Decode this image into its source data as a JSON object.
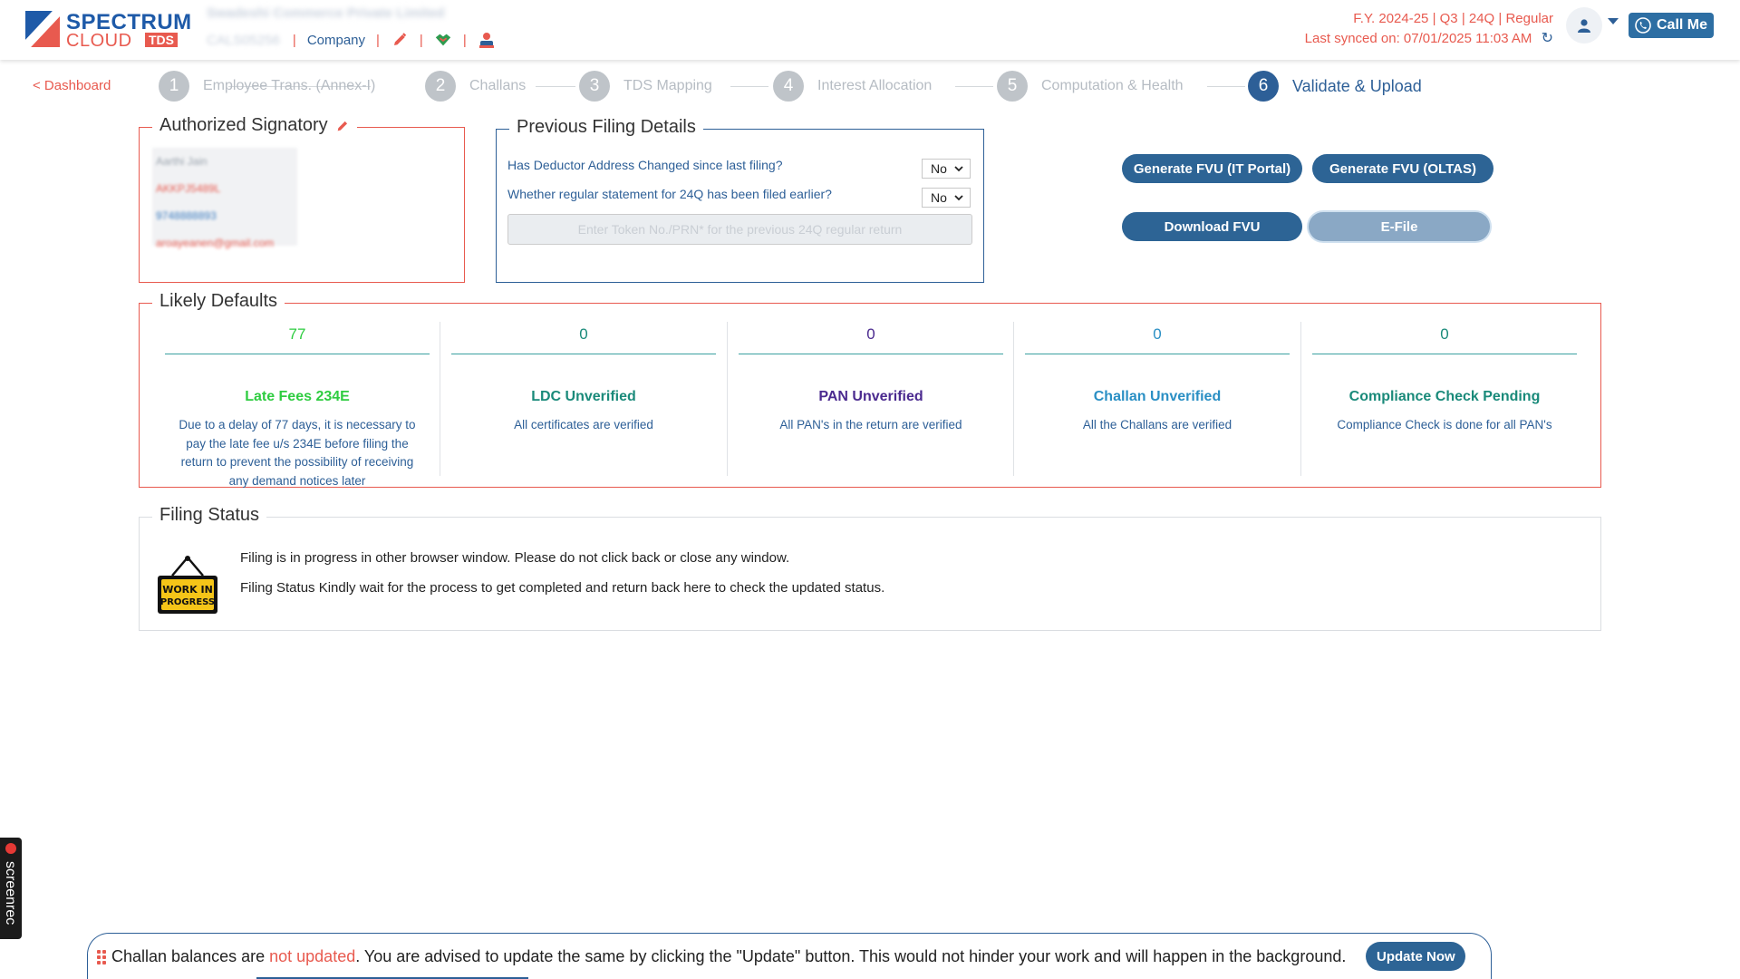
{
  "header": {
    "logo": {
      "line1": "SPECTRUM",
      "line2": "CLOUD",
      "badge": "TDS"
    },
    "company_name": "Swadeshi Commerce Private Limited",
    "tan": "CALS05256",
    "company_link": "Company",
    "separator": "|",
    "fy_line": "F.Y. 2024-25  | Q3  | 24Q | Regular",
    "sync_line": "Last synced on: 07/01/2025 11:03 AM",
    "call_me": "Call Me"
  },
  "nav": {
    "back": "< Dashboard",
    "steps": [
      {
        "num": "1",
        "label": "Employee Trans. (Annex-I)"
      },
      {
        "num": "2",
        "label": "Challans"
      },
      {
        "num": "3",
        "label": "TDS Mapping"
      },
      {
        "num": "4",
        "label": "Interest Allocation"
      },
      {
        "num": "5",
        "label": "Computation & Health"
      },
      {
        "num": "6",
        "label": "Validate & Upload"
      }
    ],
    "active_step": 6
  },
  "signatory": {
    "title": "Authorized Signatory",
    "name": "Aarthi Jain",
    "pan": "AKKPJ5489L",
    "phone": "9748888893",
    "email": "aroayeanen@gmail.com"
  },
  "previous_filing": {
    "title": "Previous Filing Details",
    "q1": "Has Deductor Address Changed since last filing?",
    "q1_value": "No",
    "q2": "Whether regular statement for 24Q has been filed earlier?",
    "q2_value": "No",
    "token_placeholder": "Enter Token No./PRN* for the previous 24Q regular return"
  },
  "actions": {
    "gen_fvu_it": "Generate FVU (IT Portal)",
    "gen_fvu_oltas": "Generate FVU (OLTAS)",
    "download_fvu": "Download FVU",
    "efile": "E-File"
  },
  "likely_defaults": {
    "title": "Likely Defaults",
    "items": [
      {
        "count": "77",
        "title": "Late Fees 234E",
        "desc": "Due to a delay of 77 days, it is necessary to pay the late fee u/s 234E before filing the return to prevent the possibility of receiving any demand notices later",
        "color": "#2ecc40"
      },
      {
        "count": "0",
        "title": "LDC Unverified",
        "desc": "All certificates are verified",
        "color": "#1a8a7a"
      },
      {
        "count": "0",
        "title": "PAN Unverified",
        "desc": "All PAN's in the return are verified",
        "color": "#4b2a8f"
      },
      {
        "count": "0",
        "title": "Challan Unverified",
        "desc": "All the Challans are verified",
        "color": "#2a8fc4"
      },
      {
        "count": "0",
        "title": "Compliance Check Pending",
        "desc": "Compliance Check is done for all PAN's",
        "color": "#1a8a7a"
      }
    ]
  },
  "filing_status": {
    "title": "Filing Status",
    "line1": "Filing is in progress in other browser window. Please do not click back or close any window.",
    "line2": "Filing Status Kindly wait for the process to get completed and return back here to check the updated status.",
    "sign_text1": "WORK IN",
    "sign_text2": "PROGRESS"
  },
  "recorder": {
    "label": "screenrec"
  },
  "banner": {
    "text_before": "Challan balances are ",
    "text_warn": "not updated",
    "text_after": ". You are advised to update the same by clicking the \"Update\" button. This would not hinder your work and will happen in the background.",
    "button": "Update Now"
  },
  "colors": {
    "brand_blue": "#2d5f97",
    "accent_red": "#e85a4f",
    "button_blue": "#2d6495"
  }
}
